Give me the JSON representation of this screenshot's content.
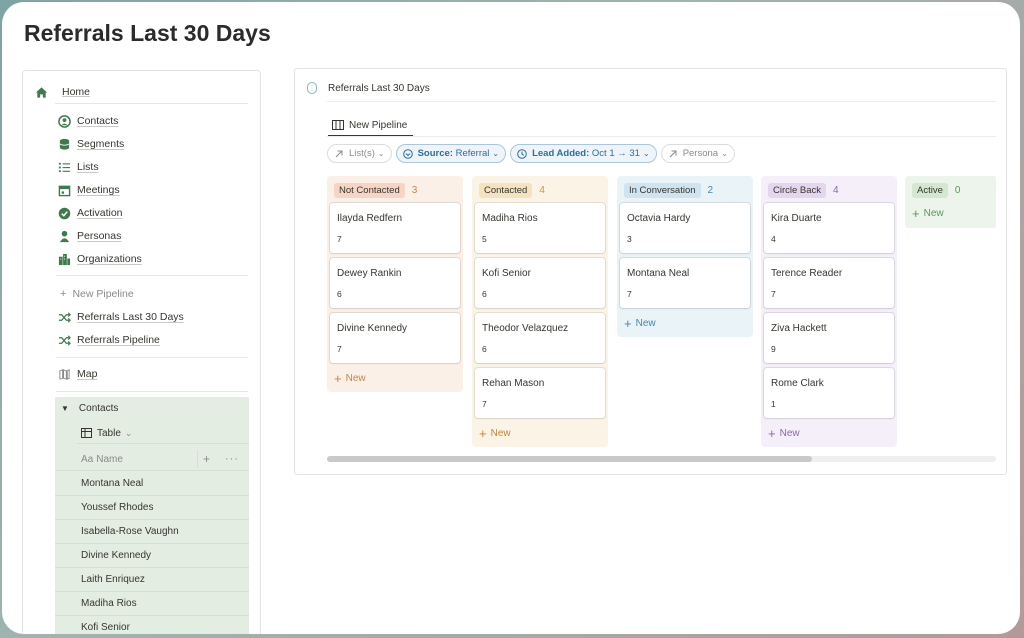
{
  "page_title": "Referrals Last 30 Days",
  "sidebar": {
    "home": "Home",
    "items": [
      {
        "label": "Contacts",
        "icon": "contacts-icon"
      },
      {
        "label": "Segments",
        "icon": "database-icon"
      },
      {
        "label": "Lists",
        "icon": "list-icon"
      },
      {
        "label": "Meetings",
        "icon": "calendar-icon"
      },
      {
        "label": "Activation",
        "icon": "check-circle-icon"
      },
      {
        "label": "Personas",
        "icon": "person-icon"
      },
      {
        "label": "Organizations",
        "icon": "building-icon"
      }
    ],
    "views": {
      "new_pipeline": "New Pipeline",
      "items": [
        "Referrals Last 30 Days",
        "Referrals Pipeline"
      ]
    },
    "map": "Map",
    "contacts_section": {
      "title": "Contacts",
      "view": "Table",
      "column_prefix": "Aa",
      "column": "Name",
      "rows": [
        "Montana Neal",
        "Youssef Rhodes",
        "Isabella-Rose Vaughn",
        "Divine Kennedy",
        "Laith Enriquez",
        "Madiha Rios",
        "Kofi Senior"
      ]
    }
  },
  "main": {
    "breadcrumb": "Referrals Last 30 Days",
    "tab": "New Pipeline",
    "filters": {
      "lists": "List(s)",
      "source_key": "Source:",
      "source_val": "Referral",
      "lead_key": "Lead Added:",
      "lead_val": "Oct 1 → 31",
      "persona": "Persona"
    },
    "columns": [
      {
        "name": "Not Contacted",
        "count": "3",
        "bg": "#faf0e8",
        "pill": "#f6d5c6",
        "count_color": "#c9824f",
        "new_color": "#c9824f",
        "cards": [
          {
            "name": "Ilayda Redfern",
            "value": "7"
          },
          {
            "name": "Dewey Rankin",
            "value": "6"
          },
          {
            "name": "Divine Kennedy",
            "value": "7"
          }
        ]
      },
      {
        "name": "Contacted",
        "count": "4",
        "bg": "#fbf4e6",
        "pill": "#f5e2bf",
        "count_color": "#c89a3c",
        "new_color": "#b8893a",
        "cards": [
          {
            "name": "Madiha Rios",
            "value": "5"
          },
          {
            "name": "Kofi Senior",
            "value": "6"
          },
          {
            "name": "Theodor Velazquez",
            "value": "6"
          },
          {
            "name": "Rehan Mason",
            "value": "7"
          }
        ]
      },
      {
        "name": "In Conversation",
        "count": "2",
        "bg": "#eaf3f8",
        "pill": "#cfe3f0",
        "count_color": "#4a86a8",
        "new_color": "#4a86a8",
        "cards": [
          {
            "name": "Octavia Hardy",
            "value": "3"
          },
          {
            "name": "Montana Neal",
            "value": "7"
          }
        ]
      },
      {
        "name": "Circle Back",
        "count": "4",
        "bg": "#f4eff9",
        "pill": "#e4d6ef",
        "count_color": "#8a6aa8",
        "new_color": "#8a6aa8",
        "cards": [
          {
            "name": "Kira Duarte",
            "value": "4"
          },
          {
            "name": "Terence Reader",
            "value": "7"
          },
          {
            "name": "Ziva Hackett",
            "value": "9"
          },
          {
            "name": "Rome Clark",
            "value": "1"
          }
        ]
      },
      {
        "name": "Active",
        "count": "0",
        "bg": "#edf4ec",
        "pill": "#d3e7d1",
        "count_color": "#5f9460",
        "new_color": "#5f9460",
        "cards": []
      }
    ],
    "new_label": "New"
  }
}
